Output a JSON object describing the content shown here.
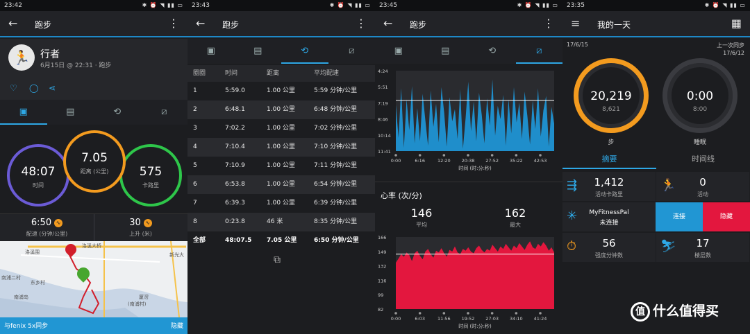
{
  "colors": {
    "accent": "#2ea8e6",
    "time_ring": "#6b5bd6",
    "distance_ring": "#f39b1f",
    "calorie_ring": "#2ec64a",
    "hr_fill": "#e3173e",
    "pace_fill": "#1f8ecb",
    "hide": "#e3173e"
  },
  "screen1": {
    "status_time": "23:42",
    "title": "跑步",
    "activity_name": "行者",
    "activity_meta": "6月15日 @ 22:31 · 跑步",
    "rings": [
      {
        "value": "48:07",
        "label": "时间"
      },
      {
        "value": "7.05",
        "label": "距离 (公里)"
      },
      {
        "value": "575",
        "label": "卡路里"
      }
    ],
    "pace": {
      "value": "6:50",
      "label": "配速 (分钟/公里)"
    },
    "ascent": {
      "value": "30",
      "label": "上升 (米)"
    },
    "map_labels": [
      "洛溪大桥",
      "洛溪围",
      "新光大",
      "东乡村",
      "南浦二村",
      "南浦岛",
      "厦滘",
      "(南浦村)"
    ],
    "sync_text": "与fenix 5x同步",
    "hide_label": "隐藏"
  },
  "screen2": {
    "status_time": "23:43",
    "title": "跑步",
    "headers": [
      "圈圈",
      "时间",
      "距离",
      "平均配速"
    ],
    "laps": [
      [
        "1",
        "5:59.0",
        "1.00 公里",
        "5:59 分钟/公里"
      ],
      [
        "2",
        "6:48.1",
        "1.00 公里",
        "6:48 分钟/公里"
      ],
      [
        "3",
        "7:02.2",
        "1.00 公里",
        "7:02 分钟/公里"
      ],
      [
        "4",
        "7:10.4",
        "1.00 公里",
        "7:10 分钟/公里"
      ],
      [
        "5",
        "7:10.9",
        "1.00 公里",
        "7:11 分钟/公里"
      ],
      [
        "6",
        "6:53.8",
        "1.00 公里",
        "6:54 分钟/公里"
      ],
      [
        "7",
        "6:39.3",
        "1.00 公里",
        "6:39 分钟/公里"
      ],
      [
        "8",
        "0:23.8",
        "46 米",
        "8:35 分钟/公里"
      ],
      [
        "全部",
        "48:07.5",
        "7.05 公里",
        "6:50 分钟/公里"
      ]
    ]
  },
  "screen3": {
    "status_time": "23:45",
    "title": "跑步",
    "hr_title": "心率 (次/分)",
    "hr_avg": {
      "value": "146",
      "label": "平均"
    },
    "hr_max": {
      "value": "162",
      "label": "最大"
    }
  },
  "screen4": {
    "status_time": "23:35",
    "title": "我的一天",
    "date_left": "17/6/15",
    "last_sync_label": "上一次同步",
    "last_sync_date": "17/6/12",
    "steps": {
      "value": "20,219",
      "goal": "8,621",
      "label": "步"
    },
    "sleep": {
      "value": "0:00",
      "goal": "8:00",
      "label": "睡眠"
    },
    "tabs": [
      "摘要",
      "时间线"
    ],
    "tiles": [
      {
        "value": "1,412",
        "label": "活动卡路里"
      },
      {
        "value": "0",
        "label": "活动"
      },
      {
        "value": "56",
        "label": "强度分钟数"
      },
      {
        "value": "17",
        "label": "楼层数"
      }
    ],
    "myfitnesspal": {
      "name": "MyFitnessPal",
      "status": "未连接"
    },
    "connect_label": "连接",
    "hide_label": "隐藏",
    "watermark": "什么值得买"
  },
  "chart_data": [
    {
      "type": "area",
      "title": "",
      "x_tick_labels": [
        "0:00",
        "6:16",
        "12:20",
        "20:38",
        "27:52",
        "35:22",
        "42:53"
      ],
      "y_tick_labels": [
        "4:24",
        "5:51",
        "7:19",
        "8:46",
        "10:14",
        "11:41"
      ],
      "xlabel": "时间 (时:分:秒)",
      "series": [
        {
          "values": [
            7.5,
            10.5,
            6.0,
            11.4,
            7.0,
            9.8,
            5.8,
            11.0,
            7.8,
            10.8,
            6.5,
            8.9,
            11.2,
            6.2,
            9.5,
            7.4,
            10.9,
            5.9,
            8.2,
            11.3,
            6.8,
            9.0,
            7.9,
            10.6,
            6.1,
            11.5,
            8.7,
            5.4,
            9.9,
            7.2,
            10.8,
            6.4,
            8.4,
            11.0,
            6.9,
            9.4,
            5.2,
            10.3,
            7.6,
            8.8,
            6.6,
            11.2,
            7.0,
            10.1,
            5.9,
            9.1,
            7.3,
            10.6,
            6.3,
            8.5,
            11.1,
            7.1,
            9.7,
            6.0,
            10.4,
            8.0,
            6.7,
            11.3,
            7.7,
            9.2
          ]
        }
      ],
      "ylim_inverted": [
        4.4,
        11.7
      ],
      "avg_line": 7.1
    },
    {
      "type": "area",
      "title": "",
      "x_tick_labels": [
        "0:00",
        "6:03",
        "11:56",
        "19:52",
        "27:03",
        "34:10",
        "41:24"
      ],
      "y_tick_labels": [
        "82",
        "99",
        "116",
        "132",
        "149",
        "166"
      ],
      "xlabel": "时间 (时:分:秒)",
      "series": [
        {
          "values": [
            136,
            141,
            146,
            143,
            148,
            145,
            138,
            147,
            150,
            144,
            140,
            149,
            152,
            146,
            142,
            150,
            148,
            153,
            147,
            143,
            151,
            149,
            155,
            148,
            146,
            152,
            150,
            154,
            149,
            147,
            153,
            156,
            151,
            148,
            152,
            150,
            157,
            153,
            149,
            155,
            152,
            158,
            154,
            150,
            156,
            153,
            159,
            155,
            151,
            157,
            161,
            154,
            152,
            158,
            155,
            160,
            156,
            150,
            154,
            148
          ]
        }
      ],
      "ylim": [
        82,
        166
      ],
      "avg_line": 146
    }
  ]
}
